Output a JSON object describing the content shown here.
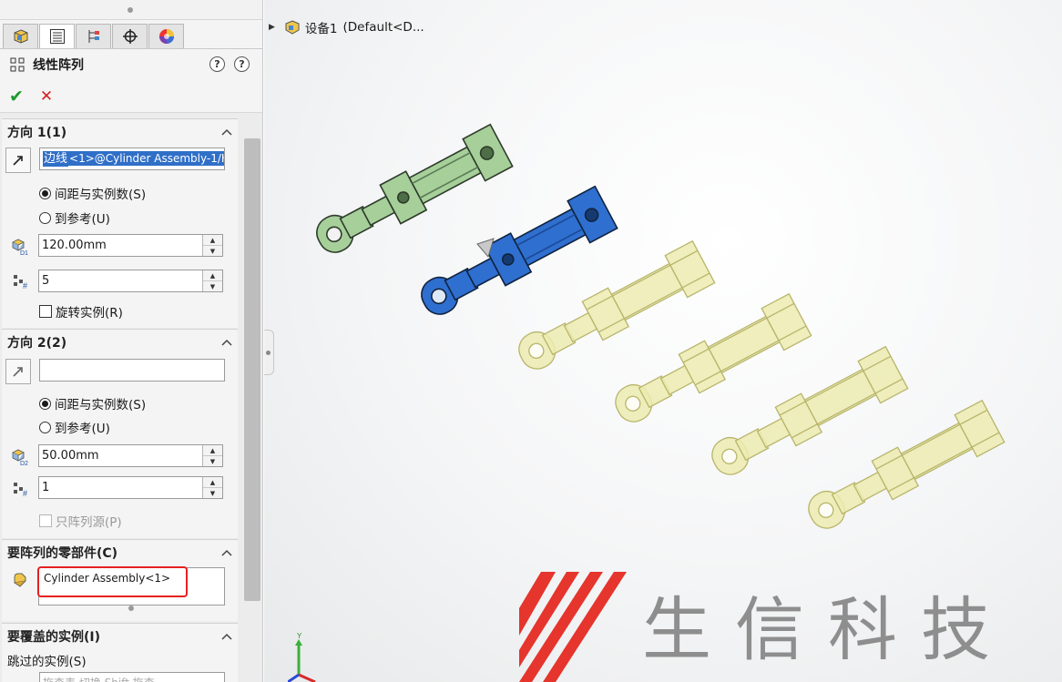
{
  "property_manager": {
    "title": "线性阵列",
    "tabs": [
      "feature-manager",
      "property-manager",
      "configuration-manager",
      "dimxpert-manager",
      "display-manager"
    ],
    "help_icons": [
      "whats-wrong",
      "help"
    ],
    "direction1": {
      "title": "方向 1(1)",
      "edge_prefix": "边线",
      "edge_rest": "<1>@Cylinder Assembly-1/H",
      "radio_spacing": "间距与实例数(S)",
      "radio_reference": "到参考(U)",
      "spacing": "120.00mm",
      "instances": "5",
      "rotate_label": "旋转实例(R)"
    },
    "direction2": {
      "title": "方向 2(2)",
      "edge": "",
      "radio_spacing": "间距与实例数(S)",
      "radio_reference": "到参考(U)",
      "spacing": "50.00mm",
      "instances": "1",
      "seed_only_label": "只阵列源(P)"
    },
    "components": {
      "title": "要阵列的零部件(C)",
      "item": "Cylinder Assembly<1>"
    },
    "skip": {
      "title": "要覆盖的实例(I)",
      "sub_label": "跳过的实例(S)",
      "hint": "拖查表 切换 Shift 拖查"
    }
  },
  "viewport": {
    "tree_item": "设备1",
    "tree_config": "(Default<D...",
    "watermark_text": "生信科技",
    "triad_label": "Y",
    "colors": {
      "green": "#a6cf9a",
      "blue": "#2f6fd0",
      "ghost": "#ecebb0",
      "logo_red": "#e5352d"
    }
  }
}
